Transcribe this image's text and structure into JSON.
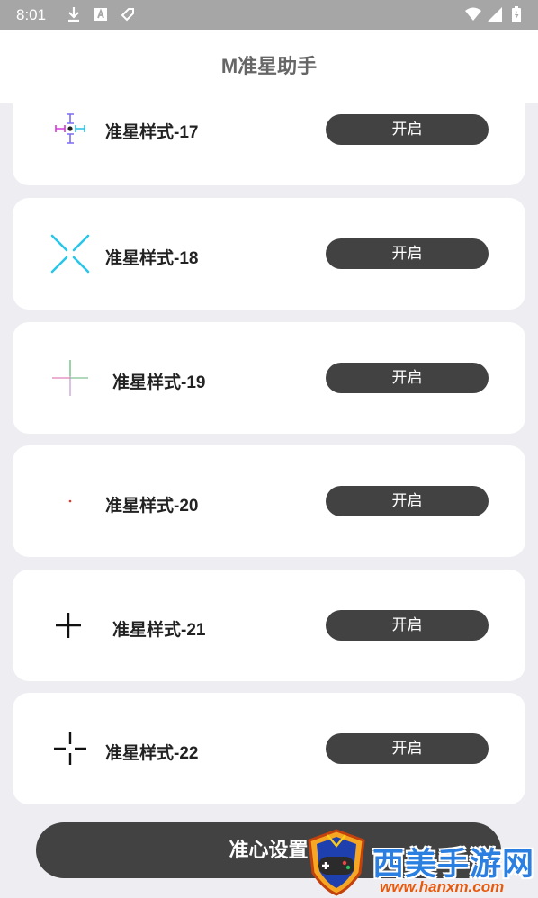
{
  "status_bar": {
    "time": "8:01",
    "left_icons": [
      "download-icon",
      "a-box-icon",
      "tag-icon"
    ],
    "right_icons": [
      "wifi-icon",
      "signal-icon",
      "battery-icon"
    ]
  },
  "app_bar": {
    "title": "M准星助手"
  },
  "crosshair_items": [
    {
      "label": "准星样式-17",
      "button": "开启",
      "icon": "crosshair-style-17-icon"
    },
    {
      "label": "准星样式-18",
      "button": "开启",
      "icon": "crosshair-style-18-icon"
    },
    {
      "label": "准星样式-19",
      "button": "开启",
      "icon": "crosshair-style-19-icon"
    },
    {
      "label": "准星样式-20",
      "button": "开启",
      "icon": "crosshair-style-20-icon"
    },
    {
      "label": "准星样式-21",
      "button": "开启",
      "icon": "crosshair-style-21-icon"
    },
    {
      "label": "准星样式-22",
      "button": "开启",
      "icon": "crosshair-style-22-icon"
    }
  ],
  "bottom_button": {
    "label": "准心设置"
  },
  "watermark": {
    "title": "西美手游网",
    "url": "www.hanxm.com"
  },
  "colors": {
    "button_bg": "#424242",
    "page_bg": "#ededf2",
    "status_bar": "#a6a6a6"
  }
}
